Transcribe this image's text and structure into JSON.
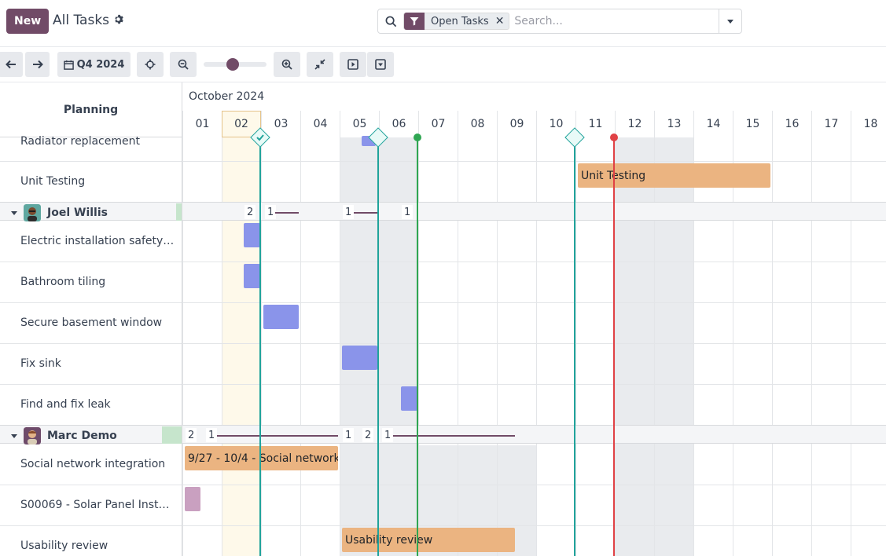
{
  "header": {
    "new_label": "New",
    "title": "All Tasks",
    "search": {
      "facet_label": "Open Tasks",
      "placeholder": "Search..."
    }
  },
  "toolbar": {
    "period_label": "Q4 2024",
    "zoom_level": 0.36
  },
  "gantt": {
    "planning_label": "Planning",
    "month_label": "October 2024",
    "days": [
      "01",
      "02",
      "03",
      "04",
      "05",
      "06",
      "07",
      "08",
      "09",
      "10",
      "11",
      "12",
      "13",
      "14",
      "15",
      "16",
      "17",
      "18"
    ],
    "rows": {
      "r0": "Radiator replacement",
      "r1": "Unit Testing",
      "r2": "Electric installation safety ch…",
      "r3": "Bathroom tiling",
      "r4": "Secure basement window",
      "r5": "Fix sink",
      "r6": "Find and fix leak",
      "r7": "Social network integration",
      "r8": "S00069 - Solar Panel Installati…",
      "r9": "Usability review"
    },
    "groups": {
      "joel": "Joel Willis",
      "marc": "Marc Demo"
    },
    "joel_counts": [
      "2",
      "1",
      "1",
      "1"
    ],
    "marc_counts": [
      "2",
      "1",
      "1",
      "2",
      "1"
    ],
    "bars": {
      "unit_testing": "Unit Testing",
      "social": "9/27 - 10/4 - Social network…",
      "usability": "Usability review"
    },
    "colors": {
      "brand": "#714b67",
      "orange": "#ebb481",
      "blue": "#8a94ea",
      "pink": "#c9a0c0",
      "teal": "#20a39b",
      "green": "#2fa652",
      "red": "#e04145"
    }
  }
}
